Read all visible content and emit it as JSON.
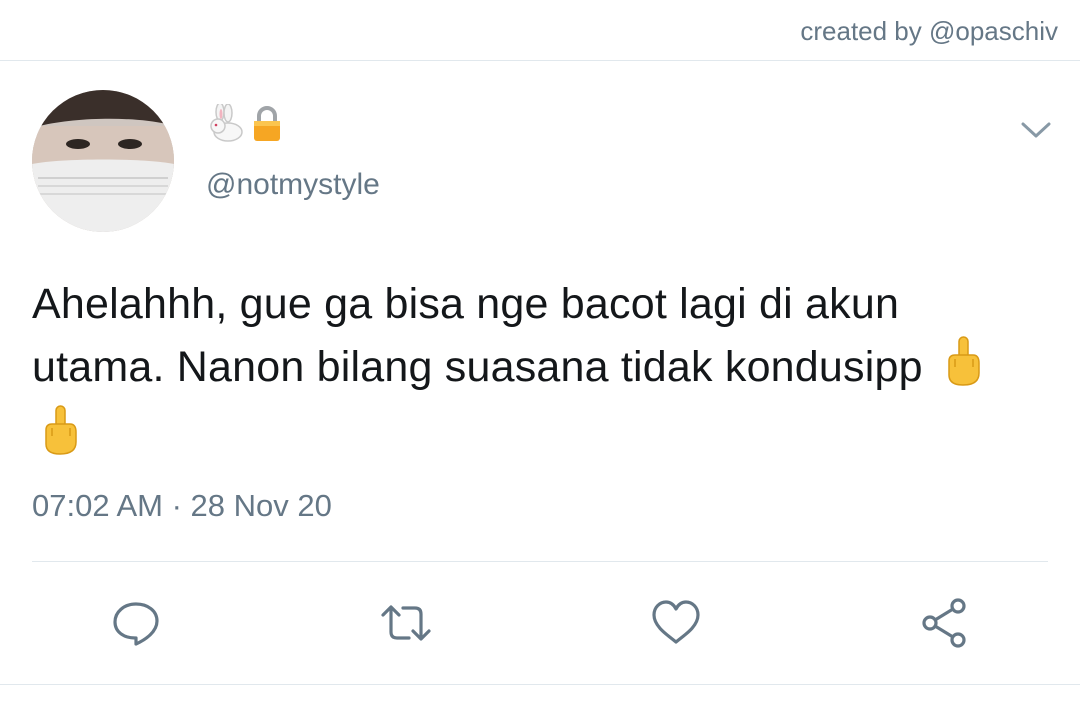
{
  "header": {
    "credit": "created by @opaschiv"
  },
  "tweet": {
    "display_name_icons": [
      "rabbit-icon",
      "lock-icon"
    ],
    "handle": "@notmystyle",
    "text": "Ahelahhh, gue ga bisa nge bacot lagi di akun utama. Nanon bilang suasana tidak kondusipp",
    "text_emojis": [
      "middle-finger-icon",
      "middle-finger-icon"
    ],
    "timestamp": "07:02 AM · 28 Nov 20"
  },
  "actions": [
    "reply-icon",
    "retweet-icon",
    "like-icon",
    "share-icon"
  ],
  "colors": {
    "secondary_text": "#657786",
    "divider": "#e1e8ed",
    "primary_text": "#14171a"
  }
}
